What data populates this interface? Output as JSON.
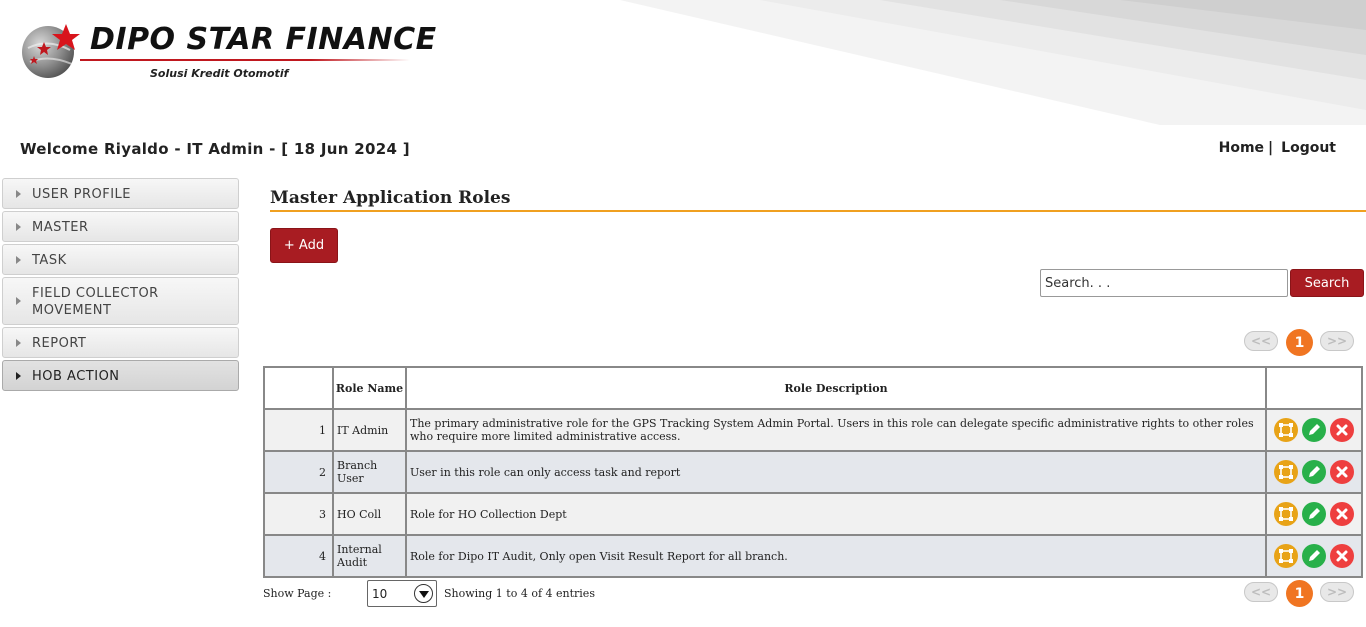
{
  "header": {
    "brand_name": "DIPO STAR FINANCE",
    "tagline": "Solusi Kredit Otomotif"
  },
  "welcome": {
    "text": "Welcome Riyaldo - IT Admin - [ 18 Jun 2024 ]"
  },
  "top_links": {
    "home": "Home",
    "separator": "|",
    "logout": "Logout"
  },
  "sidebar": {
    "items": [
      {
        "label": "USER PROFILE"
      },
      {
        "label": "MASTER"
      },
      {
        "label": "TASK"
      },
      {
        "label": "FIELD COLLECTOR MOVEMENT"
      },
      {
        "label": "REPORT"
      },
      {
        "label": "HOB ACTION"
      }
    ]
  },
  "main": {
    "title": "Master Application Roles",
    "add_label": "+ Add",
    "search_placeholder": "Search. . .",
    "search_label": "Search"
  },
  "pagination": {
    "prev": "<<",
    "current": "1",
    "next": ">>"
  },
  "table": {
    "columns": [
      "",
      "Role Name",
      "Role Description",
      ""
    ],
    "rows": [
      {
        "no": "1",
        "name": "IT Admin",
        "description": "The primary administrative role for the GPS Tracking System Admin Portal. Users in this role can delegate specific administrative rights to other roles who require more limited administrative access."
      },
      {
        "no": "2",
        "name": "Branch User",
        "description": "User in this role can only access task and report"
      },
      {
        "no": "3",
        "name": "HO Coll",
        "description": "Role for HO Collection Dept"
      },
      {
        "no": "4",
        "name": "Internal Audit",
        "description": "Role for Dipo IT Audit, Only open Visit Result Report for all branch."
      }
    ]
  },
  "footer": {
    "show_page_label": "Show Page :",
    "page_size": "10",
    "entries_info": "Showing 1 to 4 of 4 entries"
  },
  "colors": {
    "accent_red": "#a81c22",
    "title_rule": "#f0a020",
    "page_active": "#f07522",
    "access_icon": "#e8a317",
    "edit_icon": "#28b04a",
    "delete_icon": "#ee3f3f"
  }
}
